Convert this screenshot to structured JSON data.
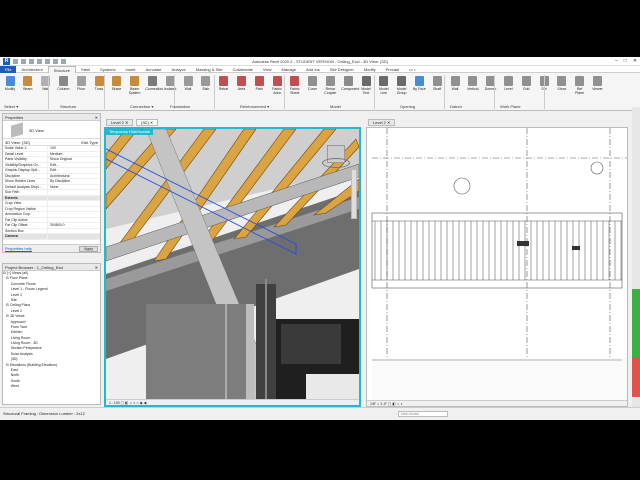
{
  "app": {
    "title": "Autodesk Revit 2020.2 - STUDENT VERSION - Ceiling_Excl - 3D View: {3D}",
    "logo": "R",
    "window_controls": [
      "–",
      "□",
      "✕"
    ]
  },
  "ribbon_tabs": [
    "File",
    "Architecture",
    "Structure",
    "Steel",
    "Systems",
    "Insert",
    "Annotate",
    "Analyze",
    "Massing & Site",
    "Collaborate",
    "View",
    "Manage",
    "Add-Ins",
    "Site Designer",
    "Modify",
    "Precast",
    "▭ •"
  ],
  "ribbon_active_tab": "Structure",
  "ribbon": {
    "buttons": [
      {
        "label": "Modify",
        "color": "#4a8bd6"
      },
      {
        "label": "Beam",
        "color": "#c98a3b"
      },
      {
        "label": "Wall",
        "color": "#b0b0b0"
      },
      {
        "label": "Column",
        "color": "#888888"
      },
      {
        "label": "Floor",
        "color": "#a0a0a0"
      },
      {
        "label": "Truss",
        "color": "#c98a3b"
      },
      {
        "label": "Brace",
        "color": "#c98a3b"
      },
      {
        "label": "Beam System",
        "color": "#c98a3b"
      },
      {
        "label": "Connection",
        "color": "#7a7a7a"
      },
      {
        "label": "Isolated",
        "color": "#999999"
      },
      {
        "label": "Wall",
        "color": "#999999"
      },
      {
        "label": "Slab",
        "color": "#999999"
      },
      {
        "label": "Rebar",
        "color": "#c05050"
      },
      {
        "label": "Area",
        "color": "#c05050"
      },
      {
        "label": "Path",
        "color": "#c05050"
      },
      {
        "label": "Fabric Area",
        "color": "#c05050"
      },
      {
        "label": "Fabric Sheet",
        "color": "#c05050"
      },
      {
        "label": "Cover",
        "color": "#909090"
      },
      {
        "label": "Rebar Coupler",
        "color": "#909090"
      },
      {
        "label": "Component",
        "color": "#8a8a8a"
      },
      {
        "label": "Model Text",
        "color": "#6a6a6a"
      },
      {
        "label": "Model Line",
        "color": "#6a6a6a"
      },
      {
        "label": "Model Group",
        "color": "#6a6a6a"
      },
      {
        "label": "By Face",
        "color": "#4a8bd6"
      },
      {
        "label": "Shaft",
        "color": "#909090"
      },
      {
        "label": "Wall",
        "color": "#909090"
      },
      {
        "label": "Vertical",
        "color": "#909090"
      },
      {
        "label": "Dormer",
        "color": "#909090"
      },
      {
        "label": "Level",
        "color": "#909090"
      },
      {
        "label": "Grid",
        "color": "#909090"
      },
      {
        "label": "Set",
        "color": "#909090"
      },
      {
        "label": "Show",
        "color": "#909090"
      },
      {
        "label": "Ref Plane",
        "color": "#909090"
      },
      {
        "label": "Viewer",
        "color": "#909090"
      }
    ],
    "groups": [
      "Select ▾",
      "Structure",
      "Connection ▾",
      "Foundation",
      "Reinforcement ▾",
      "Model",
      "Opening",
      "Datum",
      "Work Plane"
    ]
  },
  "properties": {
    "header": "Properties",
    "close": "✕",
    "type_label": "3D View",
    "selector": "3D View: {3D}",
    "edit_type": "Edit Type",
    "rows": [
      {
        "k": "Scale Value   1:",
        "v": "100"
      },
      {
        "k": "Detail Level",
        "v": "Medium"
      },
      {
        "k": "Parts Visibility",
        "v": "Show Original"
      },
      {
        "k": "Visibility/Graphics Ov...",
        "v": "Edit..."
      },
      {
        "k": "Graphic Display Opti...",
        "v": "Edit..."
      },
      {
        "k": "Discipline",
        "v": "Architectural"
      },
      {
        "k": "Show Hidden Lines",
        "v": "By Discipline"
      },
      {
        "k": "Default Analysis Displ...",
        "v": "None"
      },
      {
        "k": "Sun Path",
        "v": ""
      },
      {
        "k": "Extents",
        "v": "",
        "section": true
      },
      {
        "k": "Crop View",
        "v": ""
      },
      {
        "k": "Crop Region Visible",
        "v": ""
      },
      {
        "k": "Annotation Crop",
        "v": ""
      },
      {
        "k": "Far Clip Active",
        "v": ""
      },
      {
        "k": "Far Clip Offset",
        "v": "304800.0"
      },
      {
        "k": "Section Box",
        "v": ""
      },
      {
        "k": "Camera",
        "v": "",
        "section": true
      }
    ],
    "help_link": "Properties help",
    "apply": "Apply"
  },
  "browser": {
    "header": "Project Browser - 1_Ceiling_Excl",
    "items": [
      "⊟ [○] Views (all)",
      "   ⊟ Floor Plans",
      "        Concrete Floors",
      "        Level 1 - Floors Legend",
      "        Level 2",
      "        Site",
      "   ⊟ Ceiling Plans",
      "        Level 2",
      "   ⊟ 3D Views",
      "        Approach",
      "        From Yard",
      "        Kitchen",
      "        Living Room",
      "        Living Room - 3D",
      "        Section Perspective",
      "        Solar Analysis",
      "        {3D}",
      "   ⊟ Elevations (Building Elevation)",
      "        East",
      "        North",
      "        South",
      "        West"
    ]
  },
  "view_tabs": {
    "left": [
      {
        "label": "Level 2  ✕",
        "active": false
      },
      {
        "label": "{3D}  ✕",
        "active": true
      }
    ],
    "right": [
      {
        "label": "Level 2  ✕",
        "active": false
      }
    ]
  },
  "view3d": {
    "banner": "Temporary Hide/Isolate",
    "status": "1 : 100  ▢ ◧ ☼ ◐ ⌂ ◉ ◀"
  },
  "viewplan": {
    "status": "1/8\" = 1'-0\"  ▢ ◧ ☼ ◐"
  },
  "statusbar": {
    "text": "Structural Framing : Dimension Lumber : 2x12",
    "filter_placeholder": "Main Model"
  }
}
